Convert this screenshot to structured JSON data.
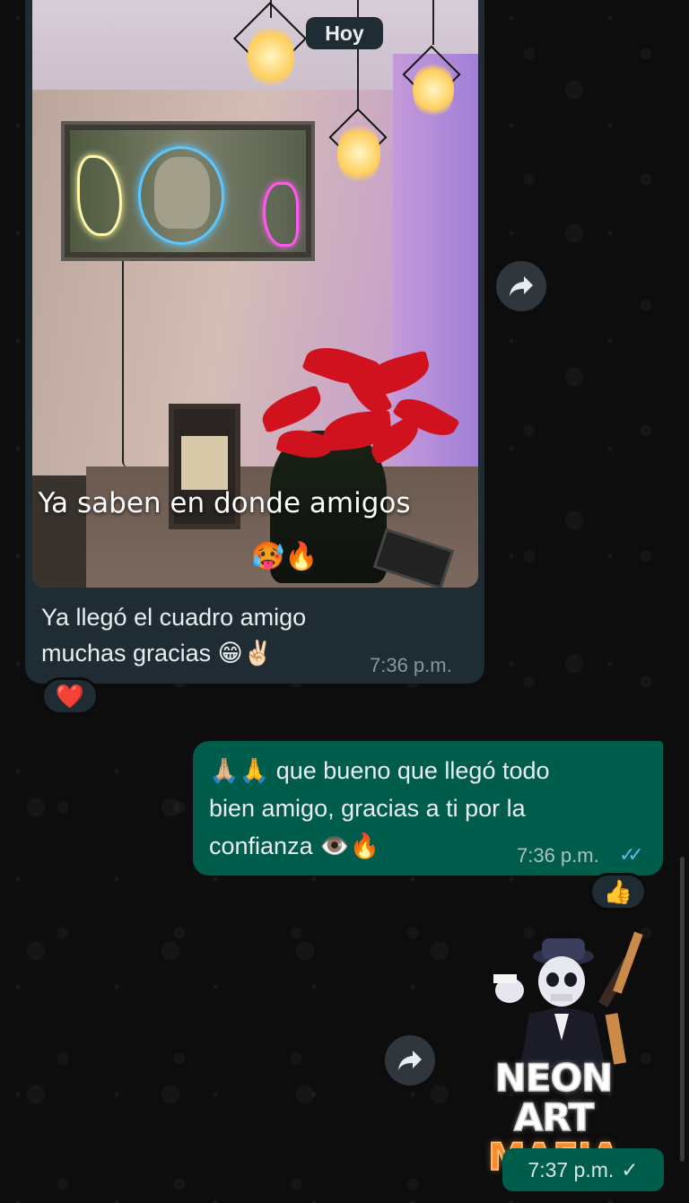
{
  "chat": {
    "date_separator": "Hoy",
    "incoming": {
      "image_caption": "Ya saben en donde amigos",
      "image_caption_emoji": "🥵🔥",
      "text_line1": "Ya llegó el cuadro amigo",
      "text_line2": "muchas gracias 😁✌🏻",
      "time": "7:36 p.m.",
      "reaction": "❤️"
    },
    "outgoing": {
      "text_line1": "🙏🏼🙏 que bueno que llegó todo",
      "text_line2": "bien amigo, gracias a ti por la",
      "text_line3": "confianza 👁️🔥",
      "time": "7:36 p.m.",
      "status": "✓✓",
      "reaction": "👍"
    },
    "sticker": {
      "line1": "NEON ART",
      "line2": "MAFIA",
      "time": "7:37 p.m.",
      "status": "✓"
    }
  },
  "icons": {
    "forward": "forward-icon",
    "read_receipt": "double-check-icon",
    "sent_receipt": "check-icon"
  },
  "colors": {
    "incoming_bubble": "#1f2c33",
    "outgoing_bubble": "#005c4b",
    "read_ticks": "#53bdeb",
    "background": "#0b0b0b"
  }
}
